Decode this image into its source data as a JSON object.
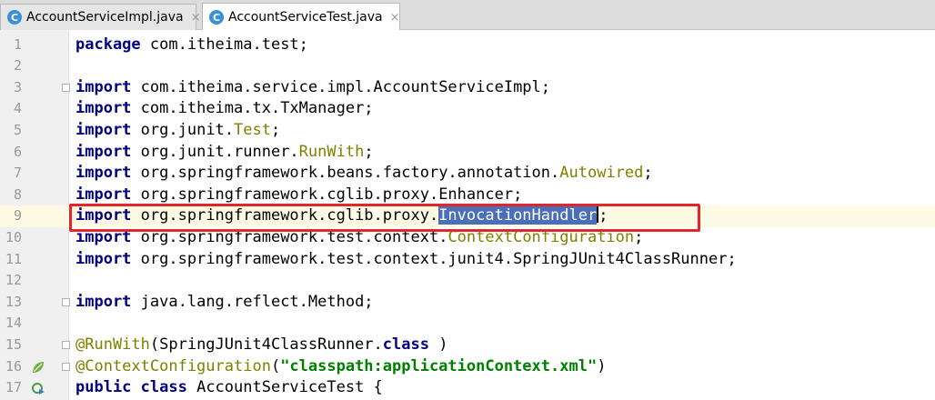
{
  "tabs": [
    {
      "label": "AccountServiceImpl.java",
      "icon": "class-icon",
      "active": false
    },
    {
      "label": "AccountServiceTest.java",
      "icon": "class-icon",
      "active": true
    }
  ],
  "tab_icon_letter": "C",
  "close_glyph": "×",
  "editor": {
    "current_line": 9,
    "lines": [
      {
        "n": "1",
        "segs": [
          [
            "kw",
            "package"
          ],
          [
            "",
            "com.itheima.test;"
          ]
        ]
      },
      {
        "n": "2",
        "segs": []
      },
      {
        "n": "3",
        "segs": [
          [
            "kw",
            "import"
          ],
          [
            "",
            "com.itheima.service.impl.AccountServiceImpl;"
          ]
        ]
      },
      {
        "n": "4",
        "segs": [
          [
            "kw",
            "import"
          ],
          [
            "",
            "com.itheima.tx.TxManager;"
          ]
        ]
      },
      {
        "n": "5",
        "segs": [
          [
            "kw",
            "import"
          ],
          [
            "",
            "org.junit."
          ],
          [
            "ann",
            "Test"
          ],
          [
            "",
            ";"
          ]
        ]
      },
      {
        "n": "6",
        "segs": [
          [
            "kw",
            "import"
          ],
          [
            "",
            "org.junit.runner."
          ],
          [
            "ann",
            "RunWith"
          ],
          [
            "",
            ";"
          ]
        ]
      },
      {
        "n": "7",
        "segs": [
          [
            "kw",
            "import"
          ],
          [
            "",
            "org.springframework.beans.factory.annotation."
          ],
          [
            "ann",
            "Autowired"
          ],
          [
            "",
            ";"
          ]
        ]
      },
      {
        "n": "8",
        "segs": [
          [
            "kw",
            "import"
          ],
          [
            "",
            "org.springframework.cglib.proxy.Enhancer;"
          ]
        ]
      },
      {
        "n": "9",
        "segs": [
          [
            "kw",
            "import"
          ],
          [
            "",
            "org.springframework.cglib.proxy."
          ],
          [
            "sel",
            "InvocationHandler"
          ],
          [
            "",
            ";"
          ]
        ]
      },
      {
        "n": "10",
        "segs": [
          [
            "kw",
            "import"
          ],
          [
            "",
            "org.springframework.test.context."
          ],
          [
            "ann",
            "ContextConfiguration"
          ],
          [
            "",
            ";"
          ]
        ]
      },
      {
        "n": "11",
        "segs": [
          [
            "kw",
            "import"
          ],
          [
            "",
            "org.springframework.test.context.junit4.SpringJUnit4ClassRunner;"
          ]
        ]
      },
      {
        "n": "12",
        "segs": []
      },
      {
        "n": "13",
        "segs": [
          [
            "kw",
            "import"
          ],
          [
            "",
            "java.lang.reflect.Method;"
          ]
        ]
      },
      {
        "n": "14",
        "segs": []
      },
      {
        "n": "15",
        "segs": [
          [
            "ann",
            "@RunWith"
          ],
          [
            "",
            "(SpringJUnit4ClassRunner."
          ],
          [
            "kw",
            "class"
          ],
          [
            "",
            ")"
          ]
        ]
      },
      {
        "n": "16",
        "segs": [
          [
            "ann",
            "@ContextConfiguration"
          ],
          [
            "",
            "("
          ],
          [
            "str",
            "\"classpath:applicationContext.xml\""
          ],
          [
            "",
            ")"
          ]
        ]
      },
      {
        "n": "17",
        "segs": [
          [
            "kw",
            "public class"
          ],
          [
            "",
            "AccountServiceTest {"
          ]
        ]
      }
    ]
  },
  "gutter_icons": {
    "16": "spring-bean-icon",
    "17": "run-test-icon"
  },
  "fold_markers": [
    "3",
    "13",
    "15",
    "16"
  ],
  "highlight_line": "9",
  "colors": {
    "keyword": "#000080",
    "annotation": "#808000",
    "string": "#008000",
    "selection": "#4a6eb8",
    "highlight_box": "#e3262b"
  }
}
